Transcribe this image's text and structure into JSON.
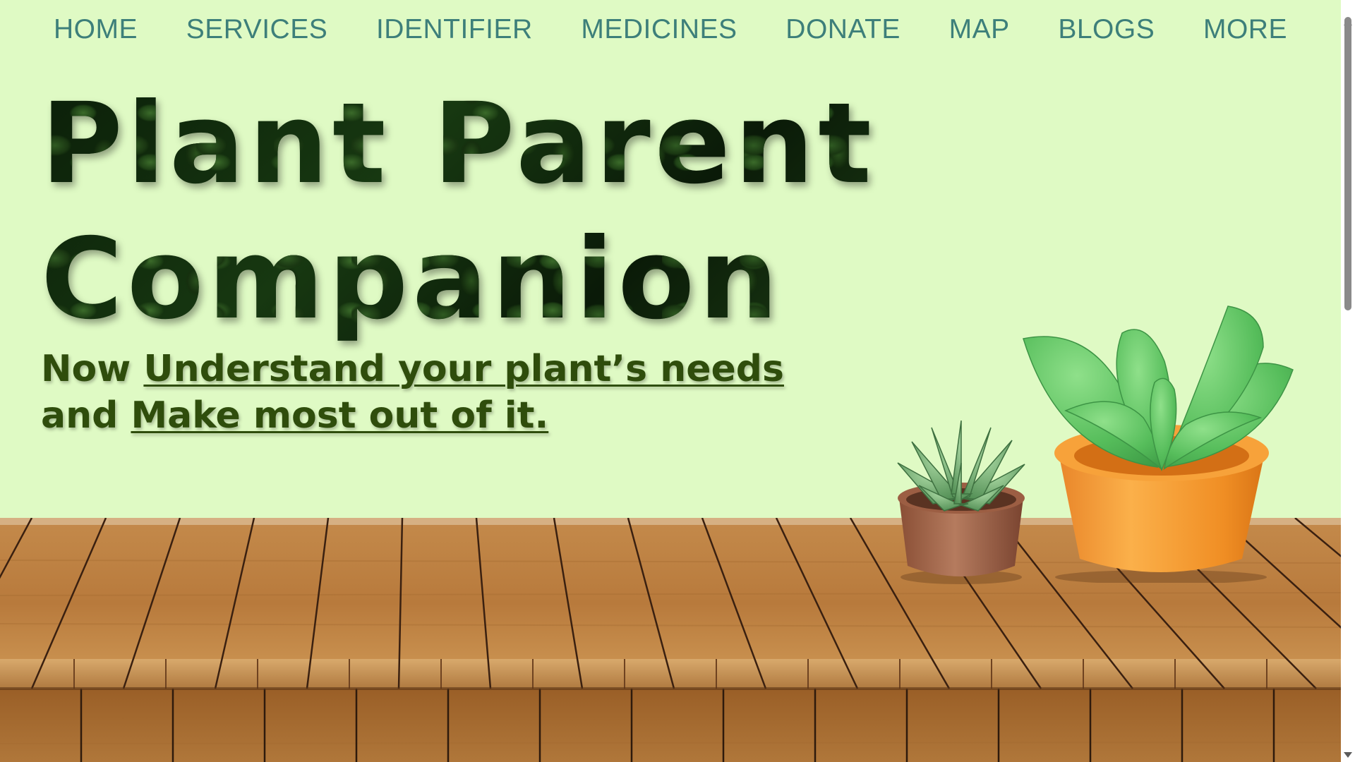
{
  "nav": {
    "items": [
      {
        "label": "HOME"
      },
      {
        "label": "SERVICES"
      },
      {
        "label": "IDENTIFIER"
      },
      {
        "label": "MEDICINES"
      },
      {
        "label": "DONATE"
      },
      {
        "label": "MAP"
      },
      {
        "label": "BLOGS"
      },
      {
        "label": "MORE"
      }
    ]
  },
  "hero": {
    "title_line1": "Plant Parent",
    "title_line2": "Companion",
    "tagline": {
      "prefix1": "Now ",
      "link1": "Understand your plant’s needs",
      "prefix2": "and ",
      "link2": "Make most out of it."
    }
  },
  "images": {
    "small_plant": "succulent-in-brown-pot",
    "big_plant": "plant-in-orange-pot",
    "table": "wooden-table"
  },
  "colors": {
    "background": "#dffac4",
    "nav_text": "#3d7f7a",
    "tagline_text": "#2f4d0c",
    "title_fill": "#0a1c08",
    "orange_pot": "#f5962a",
    "brown_pot": "#a86b4f",
    "wood": "#b9783a"
  }
}
